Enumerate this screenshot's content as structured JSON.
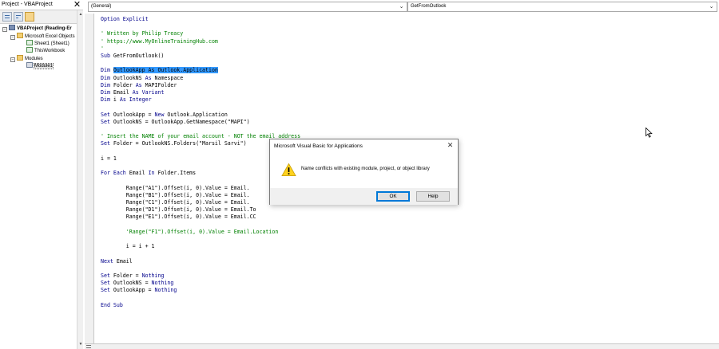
{
  "project_explorer": {
    "title": "Project - VBAProject",
    "close_glyph": "✕",
    "toolbar": [
      "view-code-icon",
      "view-object-icon",
      "toggle-folders-icon"
    ],
    "tree": [
      {
        "label": "VBAProject (Reading-Er",
        "expander": "−",
        "icon": "project-icon"
      },
      {
        "label": "Microsoft Excel Objects",
        "expander": "−",
        "icon": "folder-icon"
      },
      {
        "label": "Sheet1 (Sheet1)",
        "expander": "",
        "icon": "worksheet-icon"
      },
      {
        "label": "ThisWorkbook",
        "expander": "",
        "icon": "workbook-icon"
      },
      {
        "label": "Modules",
        "expander": "−",
        "icon": "folder-icon"
      },
      {
        "label": "Module1",
        "expander": "",
        "icon": "module-icon"
      }
    ],
    "scroll_up": "▲",
    "scroll_down": "▼"
  },
  "code_window": {
    "object_combo": "(General)",
    "procedure_combo": "GetFromOutlook",
    "combo_arrow": "⌄",
    "lines": [
      [
        {
          "t": "Option Explicit",
          "c": "kw"
        }
      ],
      [],
      [
        {
          "t": "' Written by Philip Treacy",
          "c": "cm"
        }
      ],
      [
        {
          "t": "' https://www.MyOnlineTrainingHub.com",
          "c": "cm"
        }
      ],
      [
        {
          "t": "'",
          "c": "cm"
        }
      ],
      [
        {
          "t": "Sub ",
          "c": "kw"
        },
        {
          "t": "GetFromOutlook()",
          "c": ""
        }
      ],
      [],
      [
        {
          "t": "Dim ",
          "c": "kw"
        },
        {
          "t": "OutlookApp As Outlook.Application",
          "c": "hl"
        }
      ],
      [
        {
          "t": "Dim ",
          "c": "kw"
        },
        {
          "t": "OutlookNS ",
          "c": ""
        },
        {
          "t": "As ",
          "c": "kw"
        },
        {
          "t": "Namespace",
          "c": ""
        }
      ],
      [
        {
          "t": "Dim ",
          "c": "kw"
        },
        {
          "t": "Folder ",
          "c": ""
        },
        {
          "t": "As ",
          "c": "kw"
        },
        {
          "t": "MAPIFolder",
          "c": ""
        }
      ],
      [
        {
          "t": "Dim ",
          "c": "kw"
        },
        {
          "t": "Email ",
          "c": ""
        },
        {
          "t": "As Variant",
          "c": "kw"
        }
      ],
      [
        {
          "t": "Dim ",
          "c": "kw"
        },
        {
          "t": "i ",
          "c": ""
        },
        {
          "t": "As Integer",
          "c": "kw"
        }
      ],
      [],
      [
        {
          "t": "Set ",
          "c": "kw"
        },
        {
          "t": "OutlookApp = ",
          "c": ""
        },
        {
          "t": "New ",
          "c": "kw"
        },
        {
          "t": "Outlook.Application",
          "c": ""
        }
      ],
      [
        {
          "t": "Set ",
          "c": "kw"
        },
        {
          "t": "OutlookNS = OutlookApp.GetNamespace(\"MAPI\")",
          "c": ""
        }
      ],
      [],
      [
        {
          "t": "' Insert the NAME of your email account - NOT the email address",
          "c": "cm"
        }
      ],
      [
        {
          "t": "Set ",
          "c": "kw"
        },
        {
          "t": "Folder = OutlookNS.Folders(\"Marsil Sarvi\")",
          "c": ""
        }
      ],
      [],
      [
        {
          "t": "i = 1",
          "c": ""
        }
      ],
      [],
      [
        {
          "t": "For Each ",
          "c": "kw"
        },
        {
          "t": "Email ",
          "c": ""
        },
        {
          "t": "In ",
          "c": "kw"
        },
        {
          "t": "Folder.Items",
          "c": ""
        }
      ],
      [],
      [
        {
          "t": "        Range(\"A1\").Offset(i, 0).Value = Email.",
          "c": ""
        }
      ],
      [
        {
          "t": "        Range(\"B1\").Offset(i, 0).Value = Email.",
          "c": ""
        }
      ],
      [
        {
          "t": "        Range(\"C1\").Offset(i, 0).Value = Email.",
          "c": ""
        }
      ],
      [
        {
          "t": "        Range(\"D1\").Offset(i, 0).Value = Email.To",
          "c": ""
        }
      ],
      [
        {
          "t": "        Range(\"E1\").Offset(i, 0).Value = Email.CC",
          "c": ""
        }
      ],
      [],
      [
        {
          "t": "        'Range(\"F1\").Offset(i, 0).Value = Email.Location",
          "c": "cm"
        }
      ],
      [],
      [
        {
          "t": "        i = i + 1",
          "c": ""
        }
      ],
      [],
      [
        {
          "t": "Next ",
          "c": "kw"
        },
        {
          "t": "Email",
          "c": ""
        }
      ],
      [],
      [
        {
          "t": "Set ",
          "c": "kw"
        },
        {
          "t": "Folder = ",
          "c": ""
        },
        {
          "t": "Nothing",
          "c": "kw"
        }
      ],
      [
        {
          "t": "Set ",
          "c": "kw"
        },
        {
          "t": "OutlookNS = ",
          "c": ""
        },
        {
          "t": "Nothing",
          "c": "kw"
        }
      ],
      [
        {
          "t": "Set ",
          "c": "kw"
        },
        {
          "t": "OutlookApp = ",
          "c": ""
        },
        {
          "t": "Nothing",
          "c": "kw"
        }
      ],
      [],
      [
        {
          "t": "End Sub",
          "c": "kw"
        }
      ]
    ]
  },
  "dialog": {
    "title": "Microsoft Visual Basic for Applications",
    "close_glyph": "✕",
    "icon": "warning-icon",
    "message": "Name conflicts with existing module, project, or object library",
    "ok_label": "OK",
    "help_label": "Help"
  },
  "colors": {
    "keyword": "#00008b",
    "comment": "#008000",
    "selection": "#3399ff",
    "ok_focus": "#0078d7",
    "warning": "#ffd21f"
  }
}
